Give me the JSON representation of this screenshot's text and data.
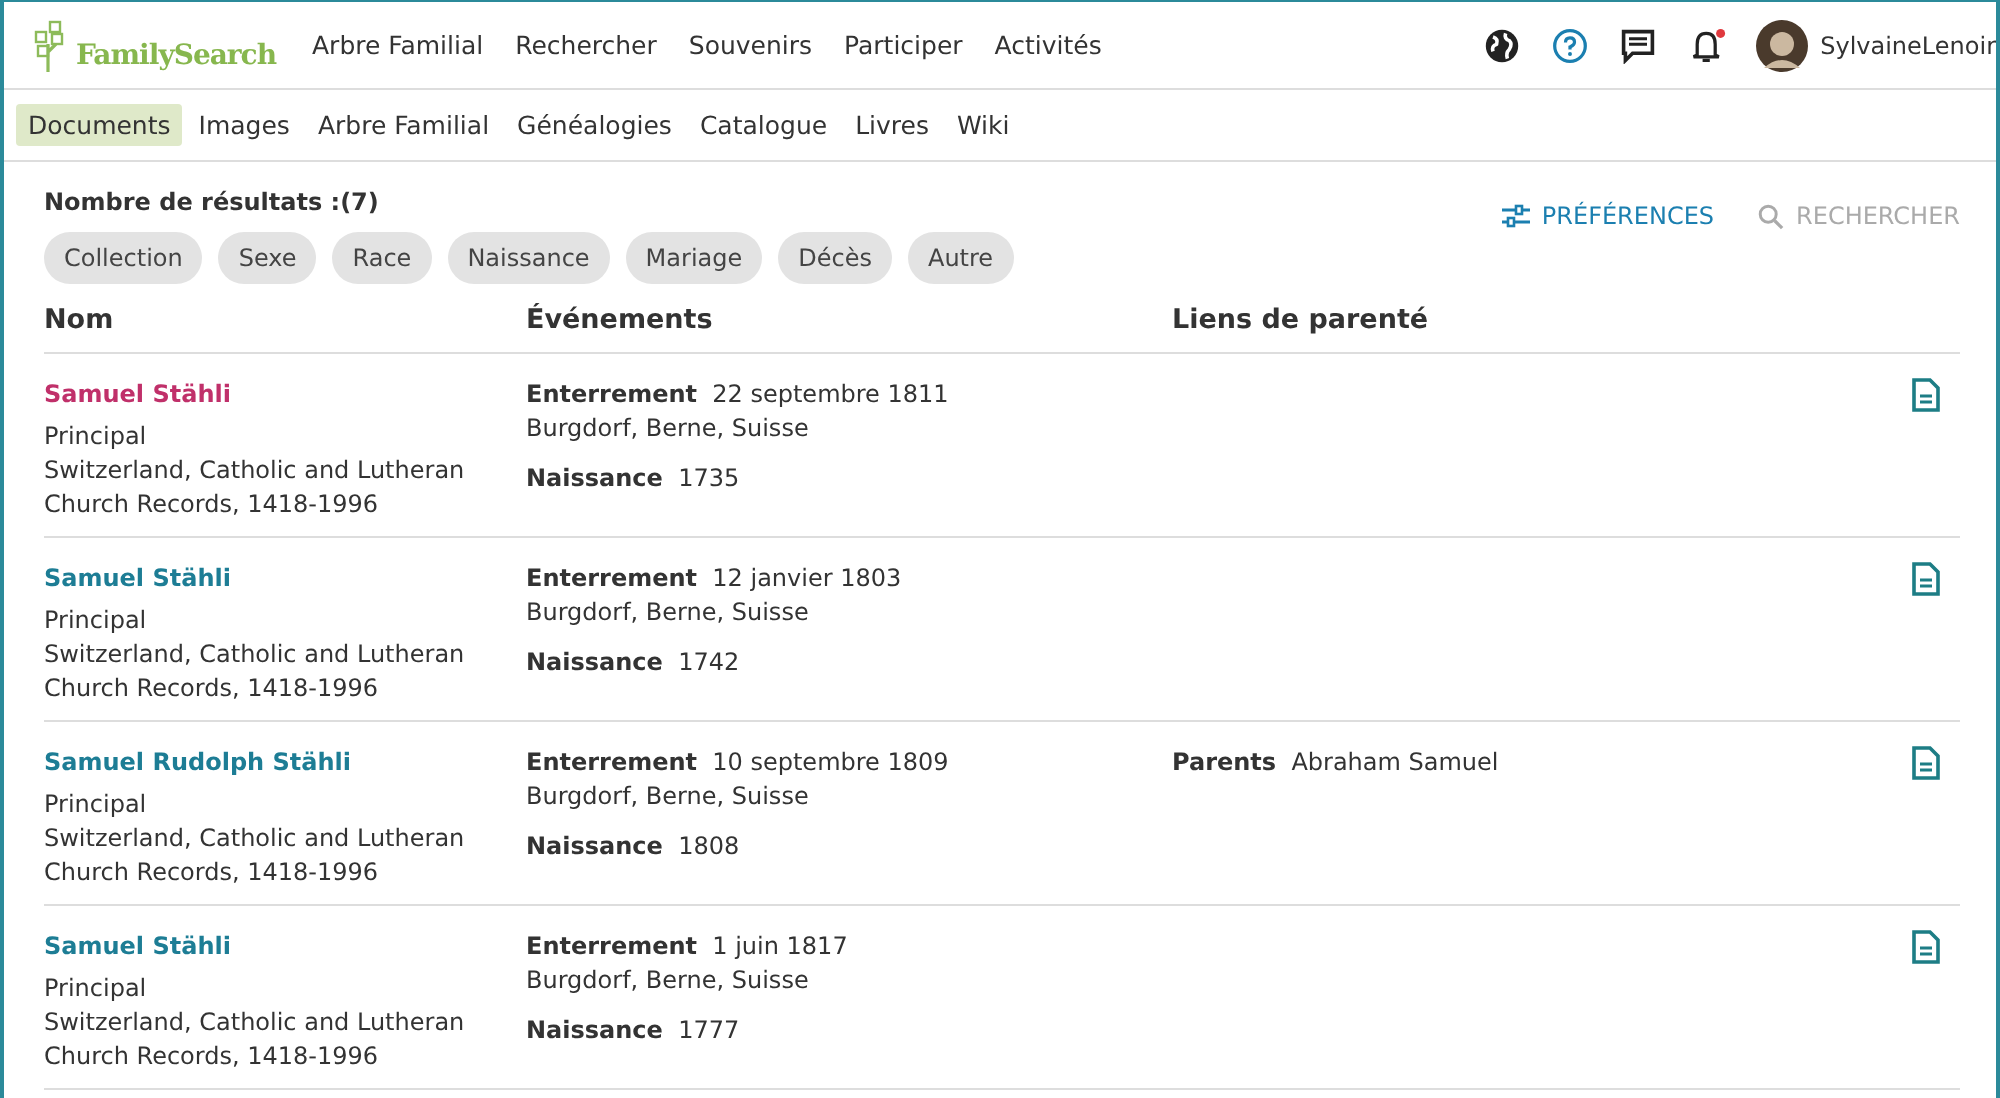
{
  "header": {
    "logo": "FamilySearch",
    "nav": [
      "Arbre Familial",
      "Rechercher",
      "Souvenirs",
      "Participer",
      "Activités"
    ],
    "notification_unread": true,
    "user": "SylvaineLenoir"
  },
  "subnav": [
    {
      "label": "Documents",
      "selected": true
    },
    {
      "label": "Images",
      "selected": false
    },
    {
      "label": "Arbre Familial",
      "selected": false
    },
    {
      "label": "Généalogies",
      "selected": false
    },
    {
      "label": "Catalogue",
      "selected": false
    },
    {
      "label": "Livres",
      "selected": false
    },
    {
      "label": "Wiki",
      "selected": false
    }
  ],
  "results_count": "Nombre de résultats :(7)",
  "filters": [
    "Collection",
    "Sexe",
    "Race",
    "Naissance",
    "Mariage",
    "Décès",
    "Autre"
  ],
  "actions": {
    "preferences": "PRÉFÉRENCES",
    "search": "RECHERCHER",
    "search_disabled": true
  },
  "table": {
    "columns": [
      "Nom",
      "Événements",
      "Liens de parenté"
    ],
    "rows": [
      {
        "name": "Samuel Stähli",
        "visited": true,
        "role": "Principal",
        "collection": "Switzerland, Catholic and Lutheran Church Records, 1418-1996",
        "events": [
          {
            "label": "Enterrement",
            "value": "22 septembre 1811",
            "place": "Burgdorf, Berne, Suisse"
          },
          {
            "label": "Naissance",
            "value": "1735"
          }
        ],
        "relations": []
      },
      {
        "name": "Samuel Stähli",
        "visited": false,
        "role": "Principal",
        "collection": "Switzerland, Catholic and Lutheran Church Records, 1418-1996",
        "events": [
          {
            "label": "Enterrement",
            "value": "12 janvier 1803",
            "place": "Burgdorf, Berne, Suisse"
          },
          {
            "label": "Naissance",
            "value": "1742"
          }
        ],
        "relations": []
      },
      {
        "name": "Samuel Rudolph Stähli",
        "visited": false,
        "role": "Principal",
        "collection": "Switzerland, Catholic and Lutheran Church Records, 1418-1996",
        "events": [
          {
            "label": "Enterrement",
            "value": "10 septembre 1809",
            "place": "Burgdorf, Berne, Suisse"
          },
          {
            "label": "Naissance",
            "value": "1808"
          }
        ],
        "relations": [
          {
            "label": "Parents",
            "value": "Abraham Samuel"
          }
        ]
      },
      {
        "name": "Samuel Stähli",
        "visited": false,
        "role": "Principal",
        "collection": "Switzerland, Catholic and Lutheran Church Records, 1418-1996",
        "events": [
          {
            "label": "Enterrement",
            "value": "1 juin 1817",
            "place": "Burgdorf, Berne, Suisse"
          },
          {
            "label": "Naissance",
            "value": "1777"
          }
        ],
        "relations": []
      }
    ]
  }
}
